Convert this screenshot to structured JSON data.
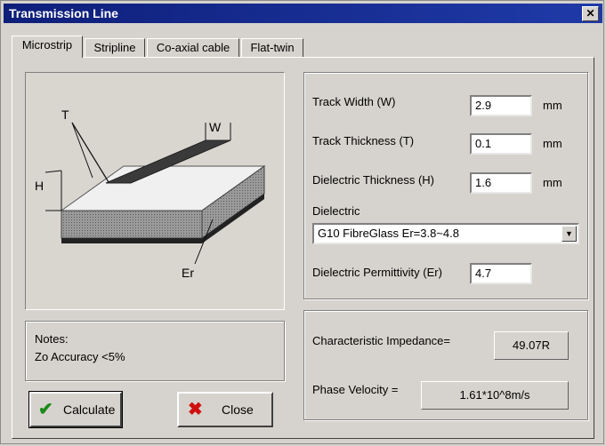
{
  "window": {
    "title": "Transmission Line",
    "close_glyph": "✕"
  },
  "tabs": [
    {
      "label": "Microstrip"
    },
    {
      "label": "Stripline"
    },
    {
      "label": "Co-axial cable"
    },
    {
      "label": "Flat-twin"
    }
  ],
  "diagram": {
    "label_t": "T",
    "label_w": "W",
    "label_h": "H",
    "label_er": "Er"
  },
  "notes": {
    "heading": "Notes:",
    "text": "Zo Accuracy <5%"
  },
  "inputs": {
    "track_width": {
      "label": "Track Width (W)",
      "value": "2.9",
      "unit": "mm"
    },
    "track_thickness": {
      "label": "Track Thickness (T)",
      "value": "0.1",
      "unit": "mm"
    },
    "dielectric_thickness": {
      "label": "Dielectric Thickness (H)",
      "value": "1.6",
      "unit": "mm"
    },
    "dielectric": {
      "label": "Dielectric",
      "value": "G10 FibreGlass Er=3.8~4.8"
    },
    "permittivity": {
      "label": "Dielectric Permittivity (Er)",
      "value": "4.7"
    }
  },
  "results": {
    "impedance": {
      "label": "Characteristic Impedance=",
      "value": "49.07R"
    },
    "phase_velocity": {
      "label": "Phase Velocity =",
      "value": "1.61*10^8m/s"
    }
  },
  "buttons": {
    "calculate": "Calculate",
    "close": "Close"
  },
  "colors": {
    "title_bar": "#0e1f7a",
    "check_icon": "#1a8a1a",
    "close_icon": "#d01010"
  }
}
